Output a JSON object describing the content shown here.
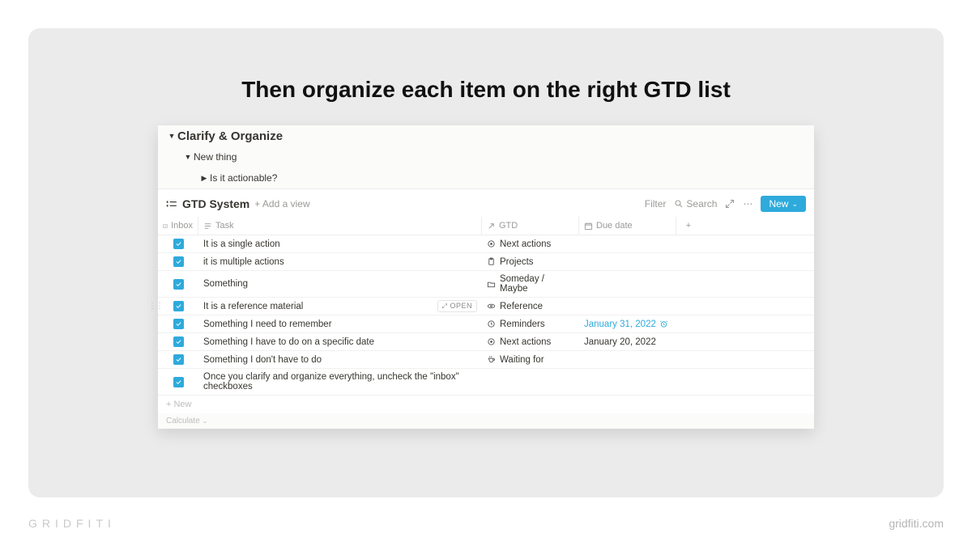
{
  "headline": "Then organize each item on the right GTD list",
  "toggle": {
    "h1": "Clarify & Organize",
    "h2": "New thing",
    "h3": "Is it actionable?"
  },
  "db": {
    "title": "GTD System",
    "add_view": "+  Add a view",
    "filter": "Filter",
    "search": "Search",
    "more": "⋯",
    "new": "New"
  },
  "columns": {
    "inbox": "Inbox",
    "task": "Task",
    "gtd": "GTD",
    "due": "Due date",
    "add": "+"
  },
  "rows": [
    {
      "task": "It is a single action",
      "gtd": "Next actions",
      "gtd_icon": "target",
      "due": "",
      "due_hl": false,
      "hover": false
    },
    {
      "task": "it is multiple actions",
      "gtd": "Projects",
      "gtd_icon": "clipboard",
      "due": "",
      "due_hl": false,
      "hover": false
    },
    {
      "task": "Something",
      "gtd": "Someday / Maybe",
      "gtd_icon": "folder",
      "due": "",
      "due_hl": false,
      "hover": false
    },
    {
      "task": "It is a reference material",
      "gtd": "Reference",
      "gtd_icon": "eye",
      "due": "",
      "due_hl": false,
      "hover": true
    },
    {
      "task": "Something I need to remember",
      "gtd": "Reminders",
      "gtd_icon": "clock",
      "due": "January 31, 2022",
      "due_hl": true,
      "hover": false
    },
    {
      "task": "Something I have to do on a specific date",
      "gtd": "Next actions",
      "gtd_icon": "target",
      "due": "January 20, 2022",
      "due_hl": false,
      "hover": false
    },
    {
      "task": "Something I don't have to do",
      "gtd": "Waiting for",
      "gtd_icon": "cup",
      "due": "",
      "due_hl": false,
      "hover": false
    },
    {
      "task": "Once you clarify and organize everything, uncheck the \"inbox\" checkboxes",
      "gtd": "",
      "gtd_icon": "",
      "due": "",
      "due_hl": false,
      "hover": false
    }
  ],
  "footer": {
    "new": "+  New",
    "calc": "Calculate"
  },
  "open_label": "OPEN",
  "brand": "GRIDFITI",
  "url": "gridfiti.com"
}
